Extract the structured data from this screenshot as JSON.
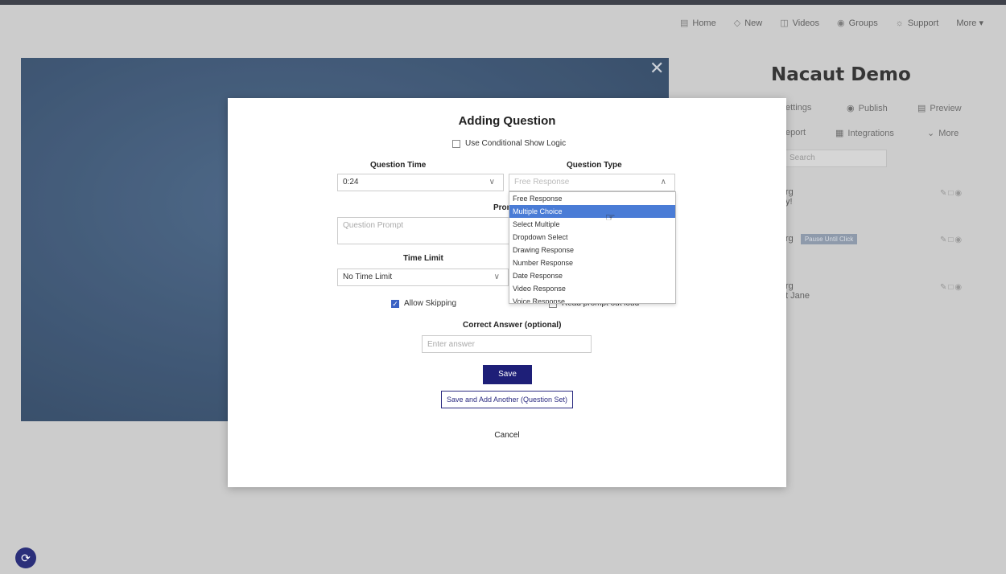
{
  "nav": {
    "items": [
      {
        "label": "Home",
        "icon": "home-icon"
      },
      {
        "label": "New",
        "icon": "plus-diamond-icon"
      },
      {
        "label": "Videos",
        "icon": "video-icon"
      },
      {
        "label": "Groups",
        "icon": "groups-icon"
      },
      {
        "label": "Support",
        "icon": "support-icon"
      },
      {
        "label": "More ▾",
        "icon": ""
      }
    ]
  },
  "right_panel": {
    "title": "Nacaut Demo",
    "actions_row1": [
      "ettings",
      "Publish",
      "Preview"
    ],
    "actions_row2": [
      "eport",
      "Integrations",
      "More"
    ],
    "search_placeholder": "Search",
    "items": [
      {
        "line1": "rg",
        "line2": "y!"
      },
      {
        "line1": "rg",
        "badge": "Pause Until Click"
      },
      {
        "line1": "rg",
        "line2": "t Jane"
      }
    ]
  },
  "modal": {
    "title": "Adding Question",
    "conditional_label": "Use Conditional Show Logic",
    "question_time_label": "Question Time",
    "question_time_value": "0:24",
    "question_type_label": "Question Type",
    "question_type_placeholder": "Free Response",
    "prompt_label": "Prompt",
    "prompt_placeholder": "Question Prompt",
    "time_limit_label": "Time Limit",
    "time_limit_value": "No Time Limit",
    "allow_skipping_label": "Allow Skipping",
    "read_prompt_label": "Read prompt out loud",
    "correct_answer_label": "Correct Answer (optional)",
    "answer_placeholder": "Enter answer",
    "save_label": "Save",
    "save_add_label": "Save and Add Another (Question Set)",
    "cancel_label": "Cancel"
  },
  "dropdown": {
    "options": [
      "Free Response",
      "Multiple Choice",
      "Select Multiple",
      "Dropdown Select",
      "Drawing Response",
      "Number Response",
      "Date Response",
      "Video Response",
      "Voice Response"
    ],
    "highlighted": "Multiple Choice"
  },
  "colors": {
    "primary": "#1e1f78",
    "highlight": "#4a7cd6",
    "checkbox": "#3b62c4"
  }
}
